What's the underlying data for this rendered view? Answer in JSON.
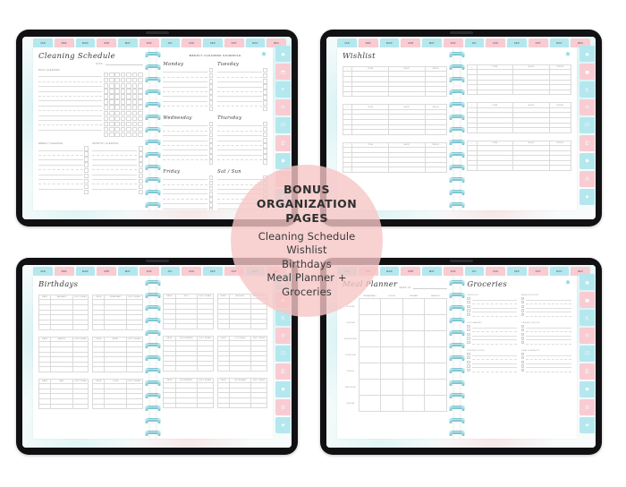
{
  "badge": {
    "heading_lines": [
      "BONUS",
      "ORGANIZATION",
      "PAGES"
    ],
    "items": [
      "Cleaning Schedule",
      "Wishlist",
      "Birthdays",
      "Meal Planner +",
      "Groceries"
    ],
    "color": "#f6c5c5"
  },
  "palette": {
    "cyan": "#b4e8ee",
    "pink": "#f8ccd2",
    "paper": "#ffffff",
    "frame": "#111114",
    "background": "#ffffff"
  },
  "months": [
    "JAN",
    "FEB",
    "MAR",
    "APR",
    "MAY",
    "JUN",
    "JUL",
    "AUG",
    "SEP",
    "OCT",
    "NOV",
    "DEC"
  ],
  "side_tabs": [
    {
      "name": "home-icon",
      "label": "HOME"
    },
    {
      "name": "calendar-icon",
      "label": "CALENDAR"
    },
    {
      "name": "meal-icon",
      "label": "MEALS"
    },
    {
      "name": "fitness-icon",
      "label": "FITNESS"
    },
    {
      "name": "notes-icon",
      "label": "NOTES"
    },
    {
      "name": "book-icon",
      "label": "BOOKS"
    },
    {
      "name": "budget-icon",
      "label": "BUDGET"
    },
    {
      "name": "password-icon",
      "label": "PASSWORDS"
    },
    {
      "name": "star-icon",
      "label": "FAVOURITES"
    }
  ],
  "tablets": [
    {
      "id": "cleaning-schedule",
      "left_page": {
        "title": "Cleaning Schedule",
        "date_label": "DATE:",
        "sections": [
          {
            "label": "DAILY CLEANING",
            "rows": 12,
            "checkbox_cols": 7
          },
          {
            "label": "WEEKLY CLEANING",
            "rows": 9
          },
          {
            "label": "MONTHLY CLEANING",
            "rows": 9
          }
        ]
      },
      "right_page": {
        "title": "WEEKLY CLEANING SCHEDULE",
        "days": [
          "Monday",
          "Tuesday",
          "Wednesday",
          "Thursday",
          "Friday",
          "Sat / Sun"
        ],
        "rows_per_day": 8
      }
    },
    {
      "id": "wishlist",
      "left_page": {
        "title": "Wishlist",
        "columns": [
          "ITEM",
          "SHOP",
          "PRICE"
        ],
        "tables": 3,
        "rows_per_table": 6
      },
      "right_page": {
        "columns": [
          "ITEM",
          "SHOP",
          "PRICE"
        ],
        "tables": 3,
        "rows_per_table": 6
      }
    },
    {
      "id": "birthdays",
      "left_page": {
        "title": "Birthdays",
        "columns": [
          "DATE",
          "GIFT IDEAS"
        ],
        "months": [
          "JANUARY",
          "FEBRUARY",
          "MARCH",
          "APRIL",
          "MAY",
          "JUNE"
        ],
        "rows_per_month": 6
      },
      "right_page": {
        "columns": [
          "DATE",
          "GIFT IDEAS"
        ],
        "months": [
          "JULY",
          "AUGUST",
          "SEPTEMBER",
          "OCTOBER",
          "NOVEMBER",
          "DECEMBER"
        ],
        "rows_per_month": 6
      }
    },
    {
      "id": "meal-planner-groceries",
      "left_page": {
        "title": "Meal Planner",
        "week_label": "WEEK OF",
        "columns": [
          "BREAKFAST",
          "LUNCH",
          "DINNER",
          "SNACKS"
        ],
        "day_rows": [
          "MONDAY",
          "TUESDAY",
          "WEDNESDAY",
          "THURSDAY",
          "FRIDAY",
          "SATURDAY",
          "SUNDAY"
        ]
      },
      "right_page": {
        "title": "Groceries",
        "categories": [
          "PRODUCE",
          "MEAT-PROTEIN",
          "DELI-BAKERY",
          "CANNED GOODS",
          "FROZEN FOODS",
          "HEALTH-BEAUTY"
        ],
        "rows_per_category": 5
      }
    }
  ]
}
